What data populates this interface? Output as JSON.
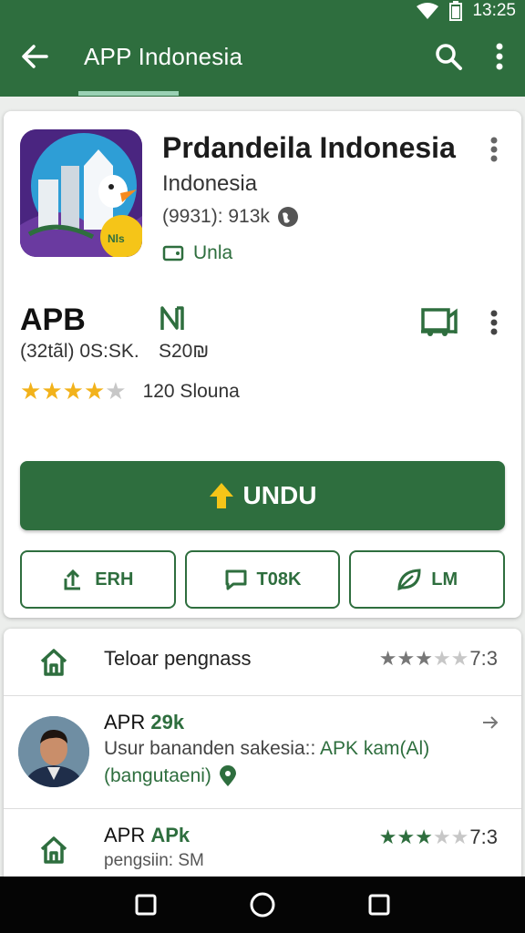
{
  "status_bar": {
    "time": "13:25"
  },
  "app_bar": {
    "title": "APP Indonesia"
  },
  "app": {
    "name": "Prdandeila Indonesia",
    "publisher": "Indonesia",
    "meta": "(9931): 913k",
    "tag": "Unla",
    "icon_badge": "Nls HAIS"
  },
  "apb": {
    "title": "APB",
    "sub_left": "(32tãl) 0S:SK.",
    "sub_right": "S20₪",
    "rating": 4,
    "rating_max": 5,
    "count": "120 Slouna"
  },
  "install_button": {
    "label": "UNDU"
  },
  "actions": [
    {
      "label": "ERH",
      "icon": "share-icon"
    },
    {
      "label": "T08K",
      "icon": "chat-icon"
    },
    {
      "label": "LM",
      "icon": "leaf-icon"
    }
  ],
  "list": {
    "row1": {
      "text": "Teloar pengnass",
      "rating": 3,
      "rating_max": 5,
      "score": "7:3"
    },
    "row2": {
      "title_prefix": "APR",
      "title_highlight": "29k",
      "line1_prefix": "Usur bananden sakesia::",
      "line1_highlight": "APK kam(Al)",
      "line2": "(bangutaeni)"
    },
    "row3": {
      "title_prefix": "APR",
      "title_highlight": "APk",
      "sub": "pengsiin: SM",
      "rating": 3,
      "rating_max": 5,
      "score": "7:3"
    }
  },
  "colors": {
    "primary": "#2e6e3e",
    "star": "#f2b21b",
    "accent": "#9ad1b4"
  }
}
